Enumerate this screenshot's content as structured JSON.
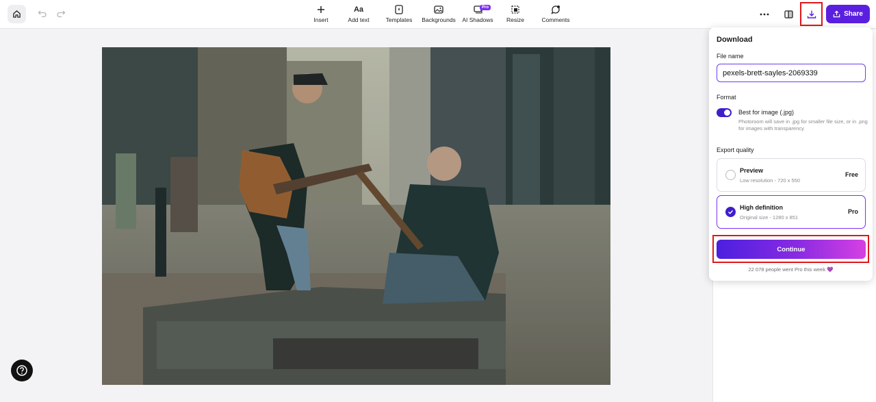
{
  "toolbar": {
    "tools": [
      {
        "label": "Insert",
        "icon": "plus-icon"
      },
      {
        "label": "Add text",
        "icon": "text-icon"
      },
      {
        "label": "Templates",
        "icon": "templates-icon"
      },
      {
        "label": "Backgrounds",
        "icon": "backgrounds-icon"
      },
      {
        "label": "AI Shadows",
        "icon": "ai-shadows-icon",
        "badge": "Pro"
      },
      {
        "label": "Resize",
        "icon": "resize-icon"
      },
      {
        "label": "Comments",
        "icon": "comments-icon"
      }
    ],
    "share_label": "Share",
    "accent": "#5b1fe0"
  },
  "download_panel": {
    "title": "Download",
    "file_name_label": "File name",
    "file_name_value": "pexels-brett-sayles-2069339",
    "format_label": "Format",
    "format_title": "Best for image (.jpg)",
    "format_description": "Photoroom will save in .jpg for smaller file size, or in .png for images with transparency",
    "format_toggle_on": true,
    "export_quality_label": "Export quality",
    "options": [
      {
        "name": "Preview",
        "desc": "Low resolution - 720 x 550",
        "tag": "Free",
        "selected": false
      },
      {
        "name": "High definition",
        "desc": "Original size - 1280 x 851",
        "tag": "Pro",
        "selected": true
      }
    ],
    "continue_label": "Continue",
    "pro_count_text": "22 078 people went Pro this week 💜"
  },
  "colors": {
    "highlight_red": "#e0151b",
    "purple": "#3f1dcb",
    "pro_badge": "#7b2ff7"
  }
}
